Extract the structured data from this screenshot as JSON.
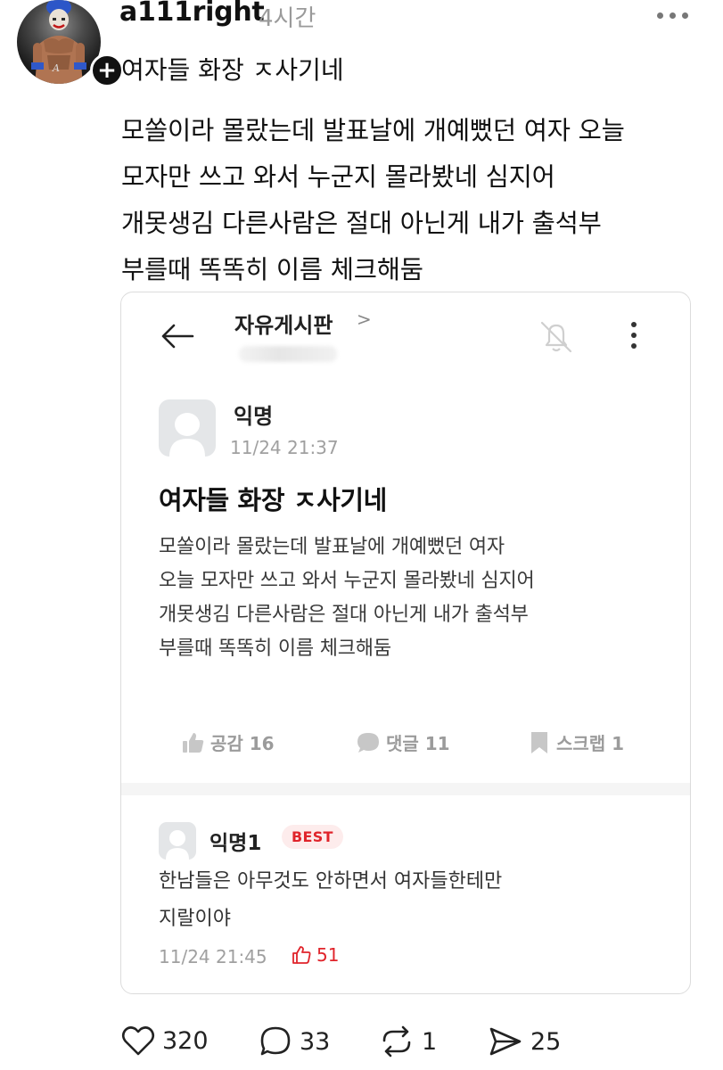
{
  "post": {
    "username": "a111right",
    "time": "4시간",
    "title": "여자들 화장 ㅈ사기네",
    "body_lines": [
      "모쏠이라 몰랐는데 발표날에 개예뻤던 여자 오늘",
      "모자만 쓰고 와서 누군지 몰라봤네 심지어",
      "개못생김 다른사람은 절대 아닌게 내가 출석부",
      "부를때 똑똑히 이름 체크해둠"
    ],
    "avatar_text": "A"
  },
  "card": {
    "board_name": "자유게시판",
    "board_chevron": ">",
    "author": "익명",
    "date": "11/24 21:37",
    "title": "여자들 화장 ㅈ사기네",
    "body_lines": [
      "모쏠이라 몰랐는데 발표날에 개예뻤던 여자",
      "오늘 모자만 쓰고 와서 누군지 몰라봤네 심지어",
      "개못생김 다른사람은 절대 아닌게 내가 출석부",
      "부를때 똑똑히 이름 체크해둠"
    ],
    "actions": {
      "like": "공감 16",
      "comment": "댓글 11",
      "scrap": "스크랩 1"
    },
    "comment": {
      "author": "익명1",
      "badge": "BEST",
      "body_lines": [
        "한남들은 아무것도 안하면서 여자들한테만",
        "지랄이야"
      ],
      "date": "11/24 21:45",
      "likes": "51"
    }
  },
  "bar": {
    "likes": "320",
    "comments": "33",
    "reposts": "1",
    "shares": "25"
  }
}
